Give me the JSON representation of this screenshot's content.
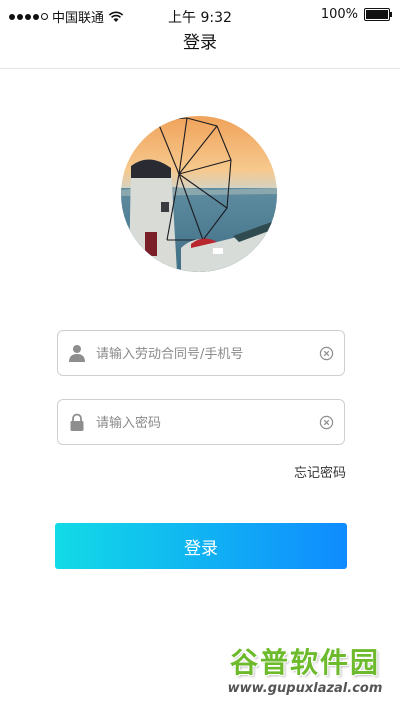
{
  "status_bar": {
    "carrier": "中国联通",
    "time": "上午 9:32",
    "battery": "100%",
    "battery_level": 1.0
  },
  "nav": {
    "title": "登录"
  },
  "avatar": {
    "icon": "windmill-seaside-photo"
  },
  "form": {
    "account": {
      "placeholder": "请输入劳动合同号/手机号",
      "value": "",
      "icon": "user-icon"
    },
    "password": {
      "placeholder": "请输入密码",
      "value": "",
      "icon": "lock-icon"
    },
    "clear_icon": "clear-icon",
    "forgot_label": "忘记密码",
    "login_label": "登录"
  },
  "colors": {
    "button_gradient_start": "#12dbe6",
    "button_gradient_end": "#0f8bff",
    "watermark_green": "#6dbb2c"
  },
  "watermark": {
    "main": "谷普软件园",
    "sub": "www.gupuxlazal.com"
  }
}
